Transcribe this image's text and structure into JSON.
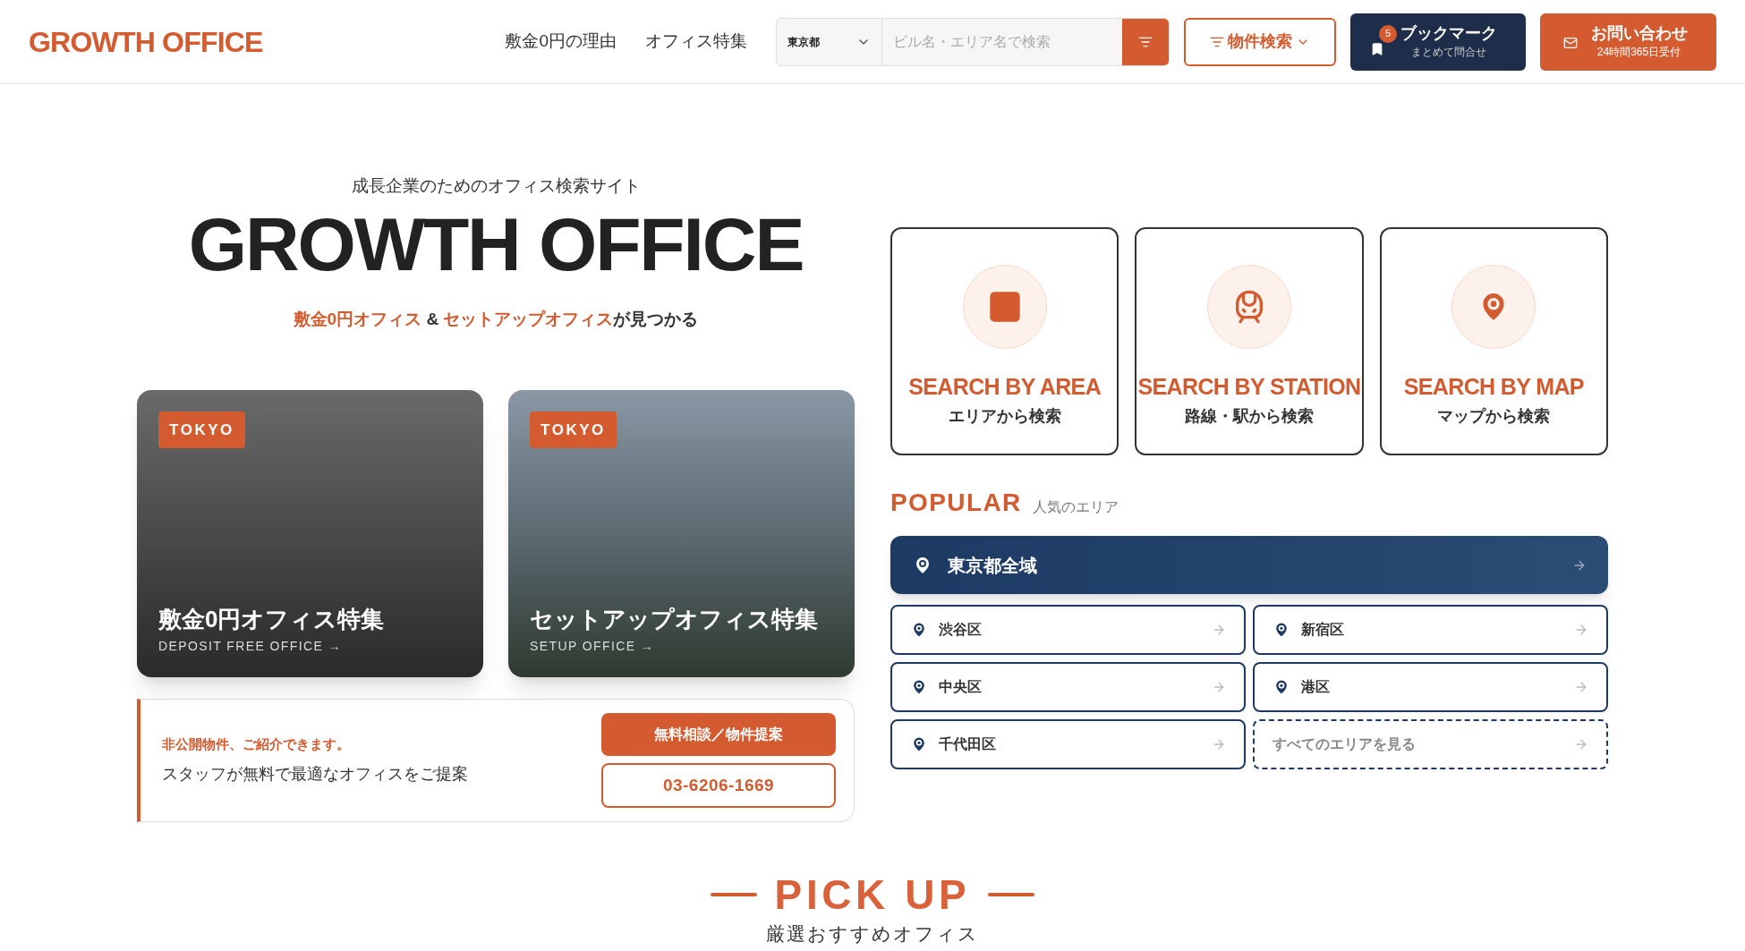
{
  "header": {
    "logo": "GROWTH OFFICE",
    "nav": [
      "敷金0円の理由",
      "オフィス特集"
    ],
    "search": {
      "prefecture": "東京都",
      "placeholder": "ビル名・エリア名で検索"
    },
    "property_search": "物件検索",
    "bookmark": {
      "badge": "5",
      "title": "ブックマーク",
      "subtitle": "まとめて問合せ"
    },
    "contact": {
      "title": "お問い合わせ",
      "subtitle": "24時間365日受付"
    }
  },
  "hero": {
    "tagline": "成長企業のためのオフィス検索サイト",
    "title": "GROWTH OFFICE",
    "lead": "**敷金0円オフィス** & **セットアップオフィス**が見つかる"
  },
  "features": [
    {
      "badge": "TOKYO",
      "title": "敷金0円オフィス特集",
      "subtitle": "DEPOSIT FREE OFFICE →"
    },
    {
      "badge": "TOKYO",
      "title": "セットアップオフィス特集",
      "subtitle": "SETUP OFFICE →"
    }
  ],
  "consult": {
    "headline": "非公開物件、ご紹介できます。",
    "text": "スタッフが無料で最適なオフィスをご提案",
    "primary_button": "無料相談／物件提案",
    "phone_button": "03-6206-1669"
  },
  "search_methods": [
    {
      "kind": "area",
      "title": "SEARCH BY AREA",
      "subtitle": "エリアから検索"
    },
    {
      "kind": "station",
      "title": "SEARCH BY STATION",
      "subtitle": "路線・駅から検索"
    },
    {
      "kind": "map",
      "title": "SEARCH BY MAP",
      "subtitle": "マップから検索"
    }
  ],
  "popular": {
    "title": "POPULAR",
    "subtitle": "人気のエリア",
    "featured": "東京都全域",
    "areas": [
      {
        "kind": "ward",
        "label": "渋谷区"
      },
      {
        "kind": "ward",
        "label": "新宿区"
      },
      {
        "kind": "ward",
        "label": "中央区"
      },
      {
        "kind": "ward",
        "label": "港区"
      },
      {
        "kind": "ward",
        "label": "千代田区"
      },
      {
        "kind": "all",
        "label": "すべてのエリアを見る"
      }
    ]
  },
  "pickup": {
    "title": "PICK UP",
    "subtitle": "厳選おすすめオフィス"
  }
}
